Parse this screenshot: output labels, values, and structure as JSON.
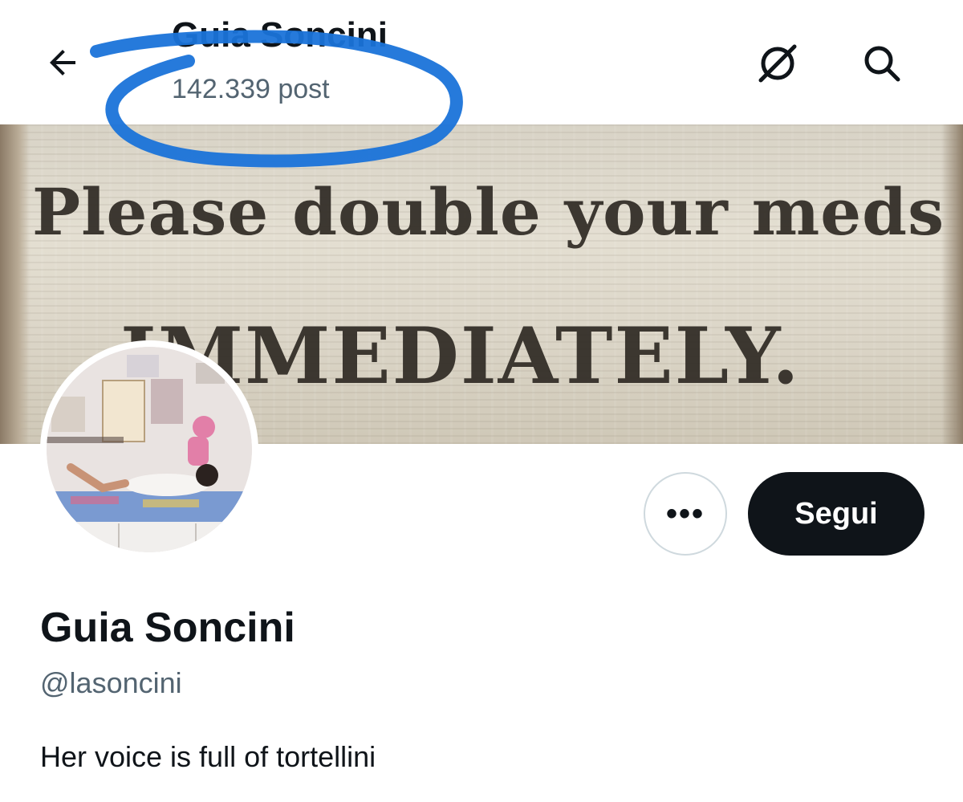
{
  "header": {
    "title": "Guia Soncini",
    "post_count": "142.339 post",
    "back_icon": "arrow-left-icon",
    "grok_icon": "grok-icon",
    "search_icon": "search-icon"
  },
  "banner": {
    "line1": "Please double your meds",
    "line2": "IMMEDIATELY."
  },
  "actions": {
    "more_label": "•••",
    "follow_label": "Segui"
  },
  "profile": {
    "name": "Guia Soncini",
    "handle": "@lasoncini",
    "bio": "Her voice is full of tortellini"
  },
  "colors": {
    "primary_text": "#0f1419",
    "secondary_text": "#536471",
    "annotation_blue": "#1a73d9",
    "button_border": "#cfd9de"
  }
}
